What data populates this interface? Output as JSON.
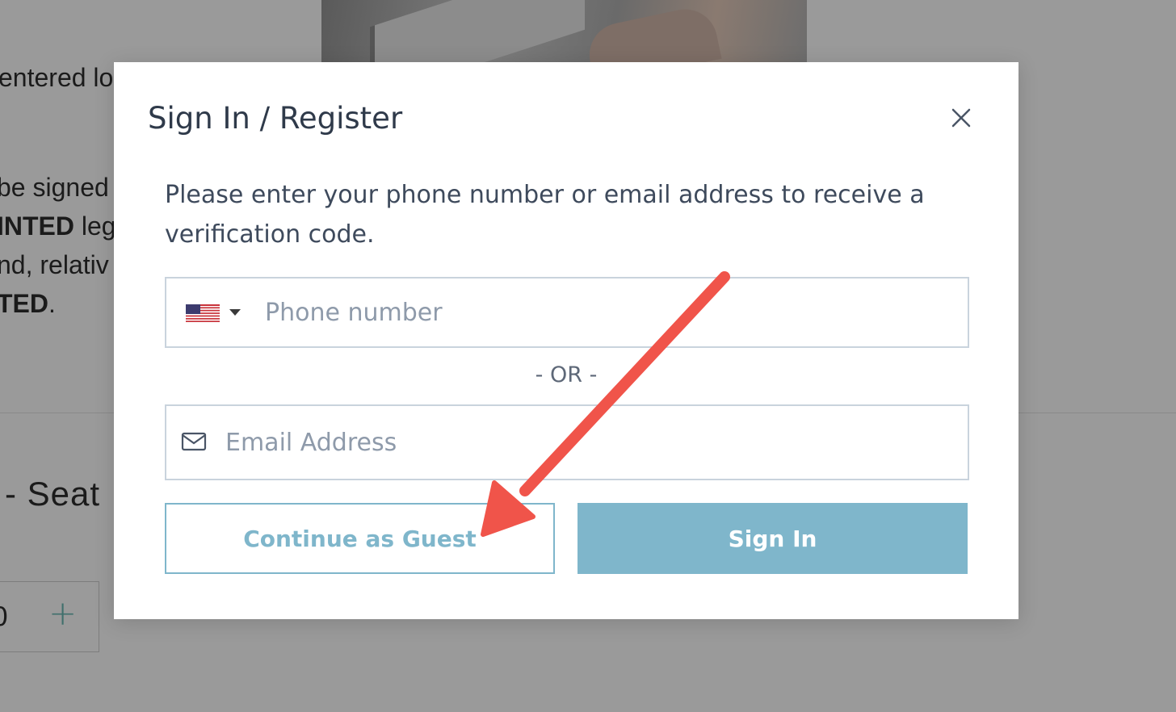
{
  "background": {
    "text_lines": [
      {
        "text": "entered lo",
        "bold": false
      },
      {
        "text": "be signed",
        "bold": false
      },
      {
        "text": "INTED",
        "bold": true,
        "suffix": " leg"
      },
      {
        "text": "nd, relativ",
        "bold": false
      },
      {
        "text": "TED",
        "bold": true,
        "suffix": "."
      }
    ],
    "heading": "- Seat",
    "stepper": {
      "value": "0",
      "plus": "+"
    }
  },
  "modal": {
    "title": "Sign In / Register",
    "close_icon": "close-icon",
    "instructions": "Please enter your phone number or email address to receive a verification code.",
    "phone": {
      "country_flag": "us-flag-icon",
      "placeholder": "Phone number",
      "value": ""
    },
    "separator": "- OR -",
    "email": {
      "icon": "mail-icon",
      "placeholder": "Email Address",
      "value": ""
    },
    "buttons": {
      "guest_label": "Continue as Guest",
      "signin_label": "Sign In"
    }
  },
  "colors": {
    "accent": "#7fb6cb",
    "overlay": "#9a9a9a",
    "annotation_arrow": "#f0544a",
    "title_text": "#2f3a4a"
  }
}
